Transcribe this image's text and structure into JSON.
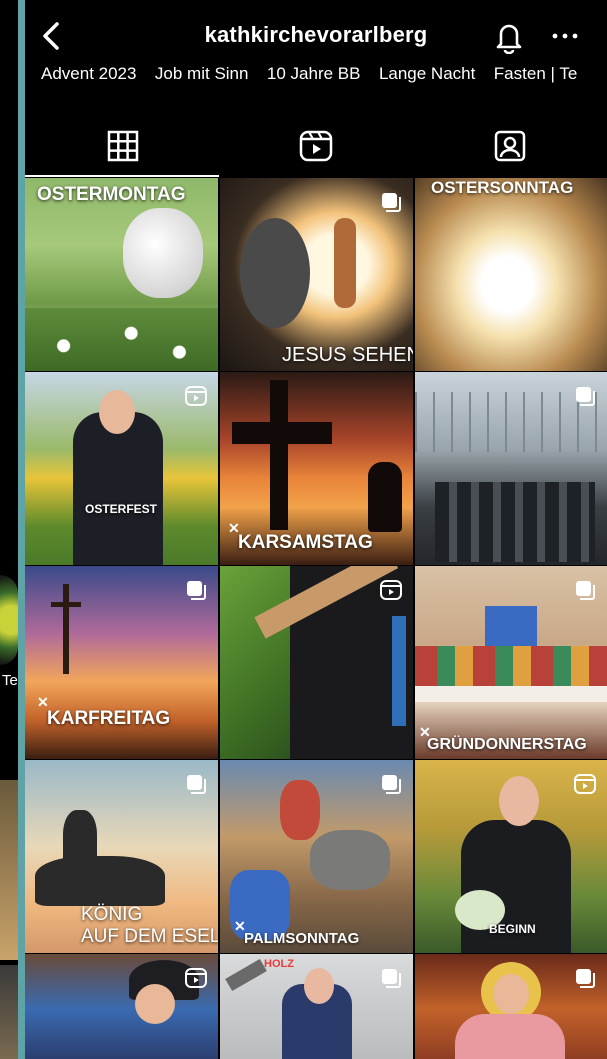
{
  "header": {
    "title": "kathkirchevorarlberg",
    "back_icon": "chevron-left-icon",
    "bell_icon": "bell-icon",
    "more_icon": "more-dots-icon"
  },
  "highlights": [
    "Advent 2023",
    "Job mit Sinn",
    "10 Jahre BB",
    "Lange Nacht",
    "Fasten | Te"
  ],
  "tabs": [
    "grid-icon",
    "reels-icon",
    "tagged-icon"
  ],
  "left_strip_text": "Te",
  "posts": [
    {
      "caption": "OSTERMONTAG",
      "type": "post"
    },
    {
      "caption": "JESUS SEHEN",
      "type": "carousel"
    },
    {
      "caption": "OSTERSONNTAG",
      "type": "post"
    },
    {
      "caption": "OSTERFEST",
      "type": "reel"
    },
    {
      "caption": "KARSAMSTAG",
      "type": "post"
    },
    {
      "caption": "",
      "type": "carousel"
    },
    {
      "caption": "KARFREITAG",
      "type": "carousel"
    },
    {
      "caption": "",
      "type": "reel"
    },
    {
      "caption": "GRÜNDONNERSTAG",
      "type": "carousel"
    },
    {
      "caption": "KÖNIG",
      "caption2": "AUF DEM ESEL?",
      "type": "carousel"
    },
    {
      "caption": "PALMSONNTAG",
      "type": "carousel"
    },
    {
      "caption": "BEGINN",
      "type": "reel"
    },
    {
      "caption": "",
      "type": "reel"
    },
    {
      "caption": "HOLZ",
      "type": "carousel"
    },
    {
      "caption": "",
      "type": "carousel"
    }
  ],
  "colors": {
    "background": "#000000",
    "accent_teal": "#5fa3a6"
  }
}
